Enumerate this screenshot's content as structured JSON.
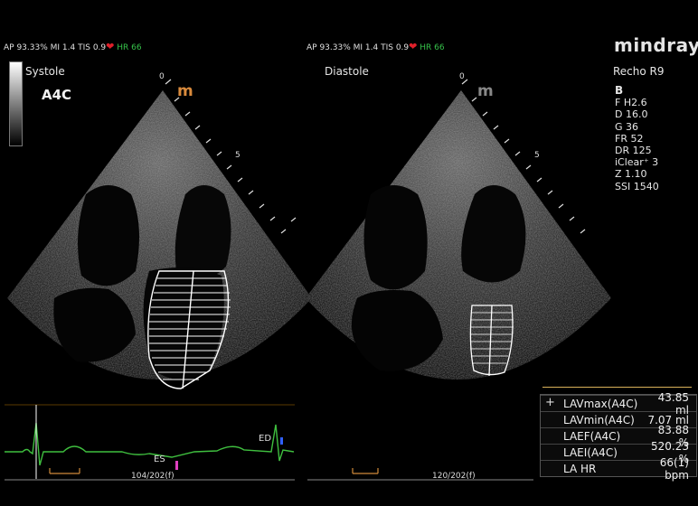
{
  "left_panel": {
    "header": {
      "ap": "AP 93.33%",
      "mi": "MI 1.4",
      "tis": "TIS 0.9",
      "hr_label": "HR",
      "hr_value": "66"
    },
    "phase": "Systole",
    "view": "A4C",
    "depth_ticks": {
      "top": "0",
      "mid": "5"
    },
    "ecg_markers": {
      "es": "ES",
      "ed": "ED"
    },
    "frame_counter": "104/202(f)"
  },
  "right_panel": {
    "header": {
      "ap": "AP 93.33%",
      "mi": "MI 1.4",
      "tis": "TIS 0.9",
      "hr_label": "HR",
      "hr_value": "66"
    },
    "phase": "Diastole",
    "depth_ticks": {
      "top": "0",
      "mid": "5"
    },
    "frame_counter": "120/202(f)"
  },
  "brand": {
    "name": "mindray",
    "probe": "Recho R9"
  },
  "params": {
    "mode": "B",
    "lines": [
      "F H2.6",
      "D 16.0",
      "G 36",
      "FR 52",
      "DR 125",
      "iClear⁺ 3",
      "Z 1.10",
      "SSI 1540"
    ]
  },
  "measurements": {
    "plus": "+",
    "rows": [
      {
        "label": "LAVmax(A4C)",
        "value": "43.85 ml"
      },
      {
        "label": "LAVmin(A4C)",
        "value": "7.07 ml"
      },
      {
        "label": "LAEF(A4C)",
        "value": "83.88 %"
      },
      {
        "label": "LAEI(A4C)",
        "value": "520.23 %"
      },
      {
        "label": "LA HR",
        "value": "66(1) bpm"
      }
    ]
  },
  "icons": {
    "heart": "heart-icon",
    "probe_mark": "probe-orientation-m-icon",
    "grayscale": "grayscale-bar"
  },
  "colors": {
    "hr_green": "#36c24a",
    "heart_red": "#e0202a",
    "ecg_green": "#3fbf3f",
    "probe_mark_left": "#d98a3c",
    "trace_white": "#ffffff"
  }
}
